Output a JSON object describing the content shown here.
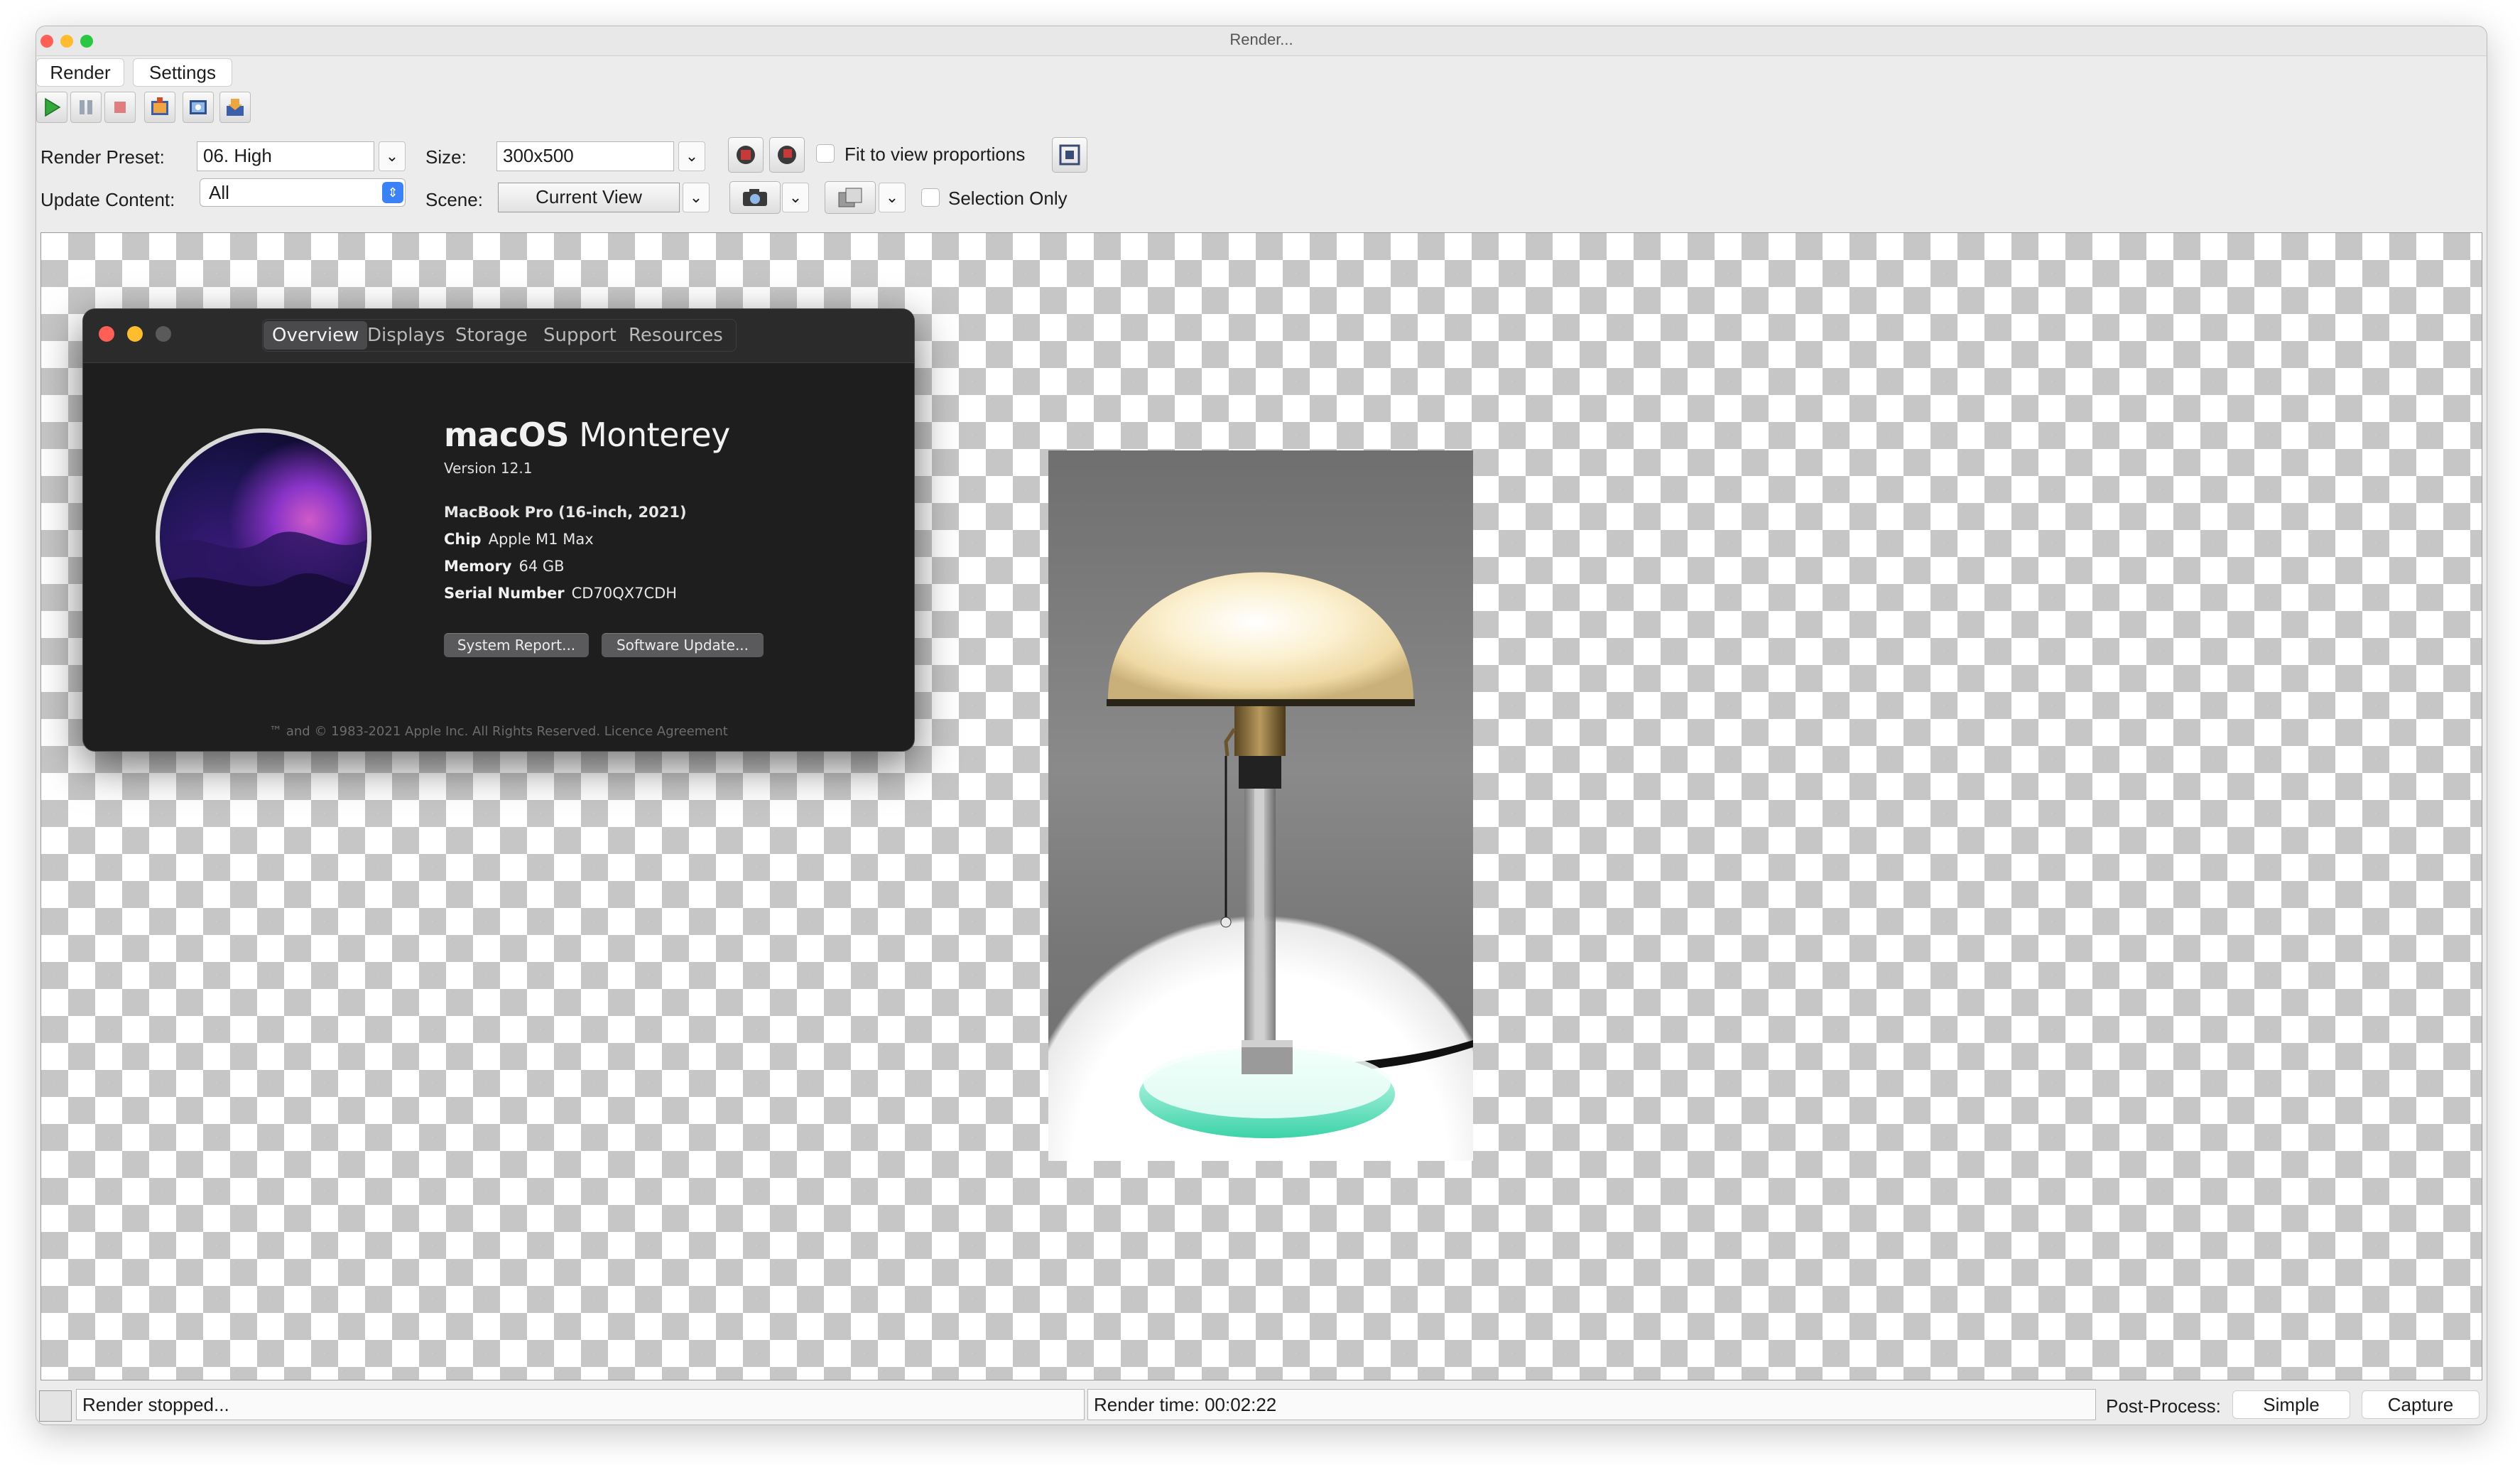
{
  "window": {
    "title": "Render..."
  },
  "tabs": [
    "Render",
    "Settings"
  ],
  "toolbar": {
    "icons": [
      "play-icon",
      "pause-icon",
      "stop-icon",
      "render-to-file-icon",
      "open-image-icon",
      "save-image-icon"
    ]
  },
  "controls": {
    "render_preset_label": "Render Preset:",
    "render_preset_value": "06. High",
    "size_label": "Size:",
    "size_value": "300x500",
    "fit_to_view_label": "Fit to view proportions",
    "update_content_label": "Update Content:",
    "update_content_value": "All",
    "scene_label": "Scene:",
    "scene_value": "Current View",
    "selection_only_label": "Selection Only"
  },
  "about": {
    "tabs": [
      "Overview",
      "Displays",
      "Storage",
      "Support",
      "Resources"
    ],
    "os_name_bold": "macOS",
    "os_name": "Monterey",
    "version": "Version 12.1",
    "model": "MacBook Pro (16-inch, 2021)",
    "chip_label": "Chip",
    "chip_value": "Apple M1 Max",
    "memory_label": "Memory",
    "memory_value": "64 GB",
    "serial_label": "Serial Number",
    "serial_value": "CD70QX7CDH",
    "system_report_button": "System Report...",
    "software_update_button": "Software Update...",
    "footer": "™ and © 1983-2021 Apple Inc. All Rights Reserved. Licence Agreement"
  },
  "status": {
    "message": "Render stopped...",
    "render_time": "Render time: 00:02:22",
    "post_process_label": "Post-Process:",
    "simple_button": "Simple",
    "capture_button": "Capture"
  },
  "colors": {
    "traffic_red": "#ff5f57",
    "traffic_yellow": "#febc2e",
    "traffic_green": "#28c840",
    "checker": "#c6c6c6",
    "about_bg": "#1e1e1f"
  }
}
